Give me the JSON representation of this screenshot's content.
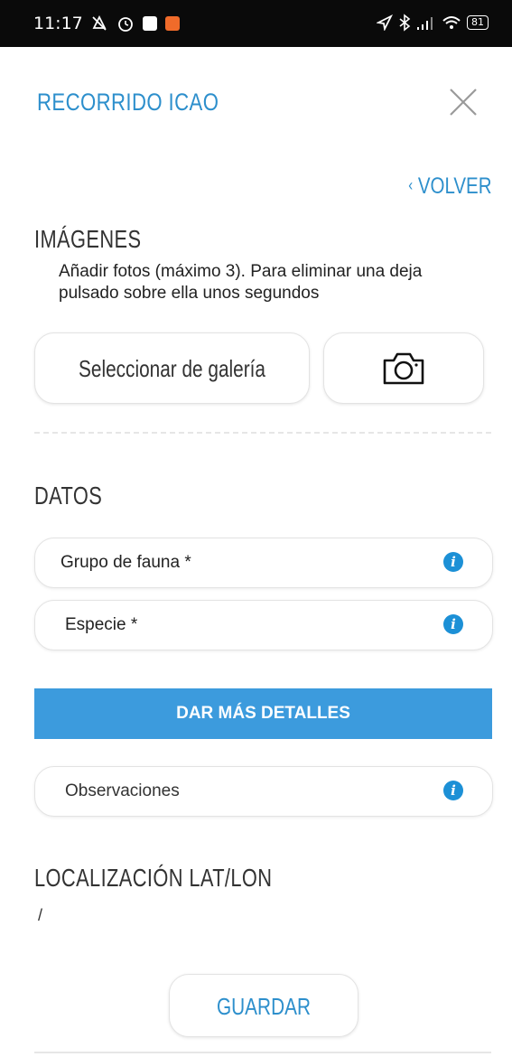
{
  "status_bar": {
    "time": "11:17",
    "battery": "81",
    "left_icons": [
      "alarm-off-icon",
      "alarm-icon",
      "app-square-icon",
      "app-orange-icon"
    ],
    "right_icons": [
      "location-arrow-icon",
      "bluetooth-icon",
      "signal-icon",
      "wifi-icon",
      "battery-icon"
    ]
  },
  "header": {
    "title": "RECORRIDO ICAO",
    "close_icon": "close-icon",
    "back_label": "VOLVER",
    "back_icon": "chevron-left-icon"
  },
  "images_section": {
    "title": "IMÁGENES",
    "helper": "Añadir fotos (máximo 3). Para eliminar una deja pulsado sobre ella unos segundos",
    "gallery_button": "Seleccionar de galería",
    "camera_icon": "camera-icon"
  },
  "data_section": {
    "title": "DATOS",
    "fields": [
      {
        "label": "Grupo de fauna *",
        "icon": "info-icon"
      },
      {
        "label": "Especie *",
        "icon": "info-icon"
      }
    ],
    "more_details_button": "DAR MÁS DETALLES",
    "observations": {
      "label": "Observaciones",
      "icon": "info-icon"
    }
  },
  "location_section": {
    "title": "LOCALIZACIÓN LAT/LON",
    "value": "/"
  },
  "save_button": "GUARDAR",
  "colors": {
    "accent": "#2d8fcc",
    "button_blue": "#3c9bdd",
    "info_blue": "#1c90d6",
    "status_bar": "#0a0a0a"
  }
}
